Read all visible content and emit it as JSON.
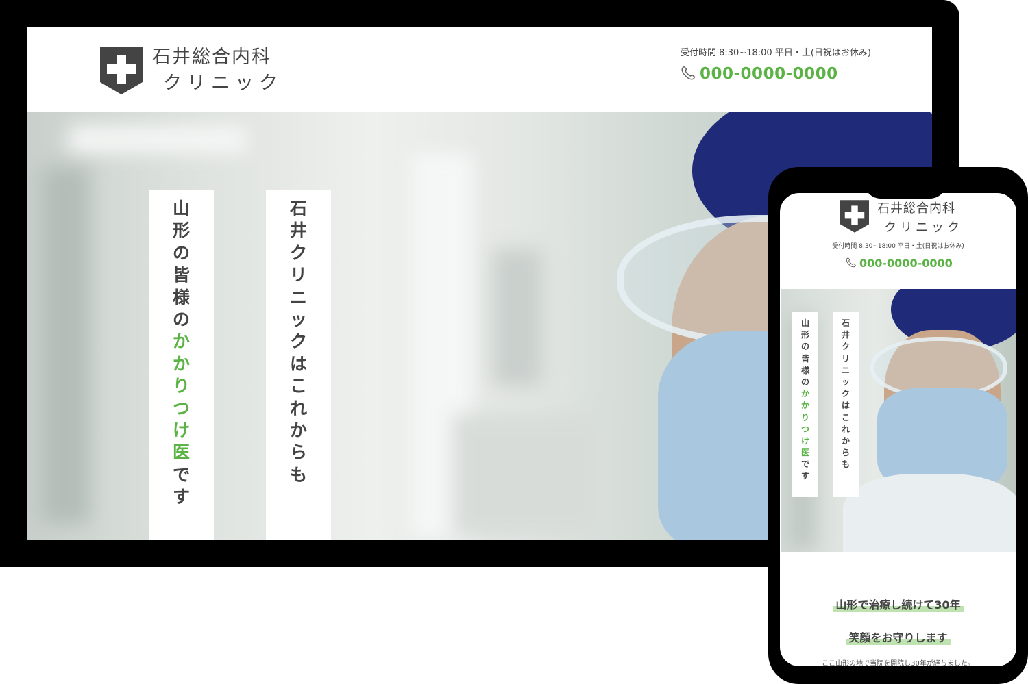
{
  "clinic": {
    "name": "石井総合内科",
    "sub": "クリニック",
    "hours": "受付時間 8:30~18:00 平日・土(日祝はお休み)",
    "phone": "000-0000-0000"
  },
  "hero": {
    "column1": [
      {
        "c": "山",
        "g": false
      },
      {
        "c": "形",
        "g": false
      },
      {
        "c": "の",
        "g": false
      },
      {
        "c": "皆",
        "g": false
      },
      {
        "c": "様",
        "g": false
      },
      {
        "c": "の",
        "g": false
      },
      {
        "c": "か",
        "g": true
      },
      {
        "c": "か",
        "g": true
      },
      {
        "c": "り",
        "g": true
      },
      {
        "c": "つ",
        "g": true
      },
      {
        "c": "け",
        "g": true
      },
      {
        "c": "医",
        "g": true
      },
      {
        "c": "で",
        "g": false
      },
      {
        "c": "す",
        "g": false
      }
    ],
    "column2": [
      {
        "c": "石",
        "g": false
      },
      {
        "c": "井",
        "g": false
      },
      {
        "c": "ク",
        "g": false
      },
      {
        "c": "リ",
        "g": false
      },
      {
        "c": "ニ",
        "g": false
      },
      {
        "c": "ッ",
        "g": false
      },
      {
        "c": "ク",
        "g": false
      },
      {
        "c": "は",
        "g": false
      },
      {
        "c": "こ",
        "g": false
      },
      {
        "c": "れ",
        "g": false
      },
      {
        "c": "か",
        "g": false
      },
      {
        "c": "ら",
        "g": false
      },
      {
        "c": "も",
        "g": false
      }
    ]
  },
  "mobile": {
    "tagline1": "山形で治療し続けて30年",
    "tagline2": "笑顔をお守りします",
    "body": "ここ山形の地で当院を開院し30年が経ちました。"
  },
  "colors": {
    "accent": "#5bb345",
    "text": "#444444",
    "highlight": "#bfe3b0",
    "frame": "#000000"
  },
  "icons": [
    "shield-cross-icon",
    "phone-icon"
  ]
}
